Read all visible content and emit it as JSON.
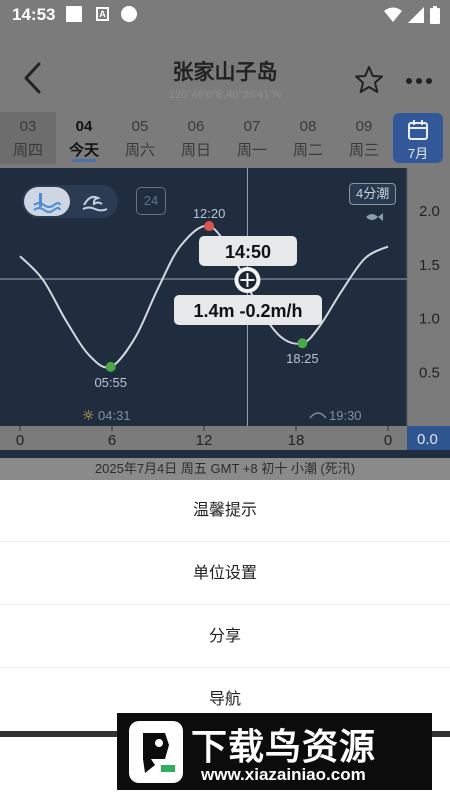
{
  "status_bar": {
    "time": "14:53",
    "a_icon": "A"
  },
  "header": {
    "title": "张家山子岛",
    "coords": "120°46'6\"E,40°26'41\"N",
    "icons": {
      "back": "back-arrow-icon",
      "favorite": "star-icon",
      "more": "more-icon"
    }
  },
  "dates": [
    {
      "num": "03",
      "weekday": "周四"
    },
    {
      "num": "04",
      "weekday": "今天"
    },
    {
      "num": "05",
      "weekday": "周六"
    },
    {
      "num": "06",
      "weekday": "周日"
    },
    {
      "num": "07",
      "weekday": "周一"
    },
    {
      "num": "08",
      "weekday": "周二"
    },
    {
      "num": "09",
      "weekday": "周三"
    }
  ],
  "month_button": "7月",
  "chart_controls": {
    "calendar_day": "24",
    "tide_badge": "4分潮"
  },
  "chart_data": {
    "type": "line",
    "title": "",
    "xlabel": "",
    "ylabel": "",
    "xlim": [
      0,
      24
    ],
    "ylim": [
      0,
      2.0
    ],
    "x_tick_labels": [
      "0",
      "6",
      "12",
      "18",
      "0"
    ],
    "x_ticks": [
      0,
      6,
      12,
      18,
      24
    ],
    "y_tick_labels": [
      "2.0",
      "1.5",
      "1.0",
      "0.5"
    ],
    "y_ticks": [
      2.0,
      1.5,
      1.0,
      0.5
    ],
    "y_zero_label": "0.0",
    "series": [
      {
        "x": [
          0,
          1.5,
          3,
          4.5,
          5.917,
          7.5,
          9,
          10.5,
          12.333,
          14,
          15.5,
          17,
          18.417,
          19.5,
          21,
          22.5,
          24
        ],
        "y": [
          1.58,
          1.36,
          0.98,
          0.66,
          0.55,
          0.82,
          1.28,
          1.68,
          1.86,
          1.55,
          1.12,
          0.83,
          0.77,
          0.92,
          1.26,
          1.56,
          1.67
        ]
      }
    ],
    "low_points": [
      {
        "time": "05:55",
        "x": 5.917,
        "y": 0.55
      },
      {
        "time": "18:25",
        "x": 18.417,
        "y": 0.77
      }
    ],
    "high_points": [
      {
        "time": "12:20",
        "x": 12.333,
        "y": 1.86
      }
    ],
    "cursor": {
      "time": "14:50",
      "x": 14.833,
      "y": 1.4,
      "readout": "1.4m  -0.2m/h"
    },
    "sunrise": "04:31",
    "sunset": "19:30"
  },
  "summary": "2025年7月4日  周五  GMT +8  初十  小潮 (死汛)",
  "sheet": {
    "items": [
      "温馨提示",
      "单位设置",
      "分享",
      "导航"
    ]
  },
  "watermark": {
    "title": "下载鸟资源",
    "url": "www.xiazainiao.com"
  }
}
